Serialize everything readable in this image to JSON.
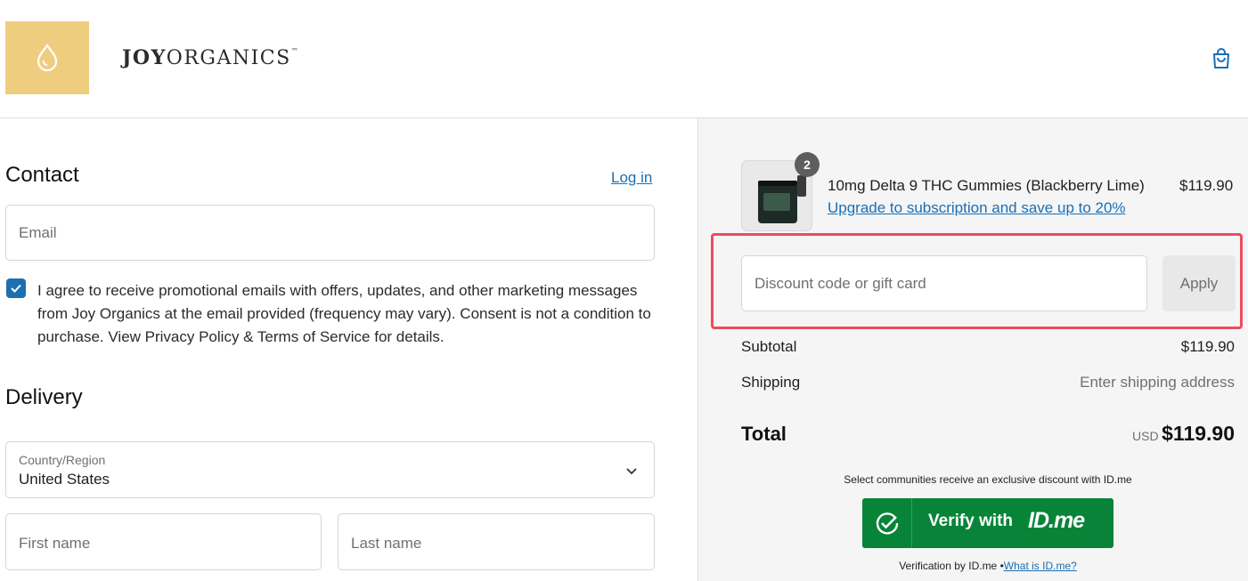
{
  "header": {
    "brand_bold": "JOY",
    "brand_regular": "ORGANICS",
    "brand_tm": "™",
    "icons": {
      "logo": "droplet-icon",
      "cart": "shopping-bag-icon"
    },
    "logo_color": "#efcd7e"
  },
  "contact": {
    "title": "Contact",
    "login_label": "Log in",
    "email_placeholder": "Email",
    "consent_checked": true,
    "consent_text": "I agree to receive promotional emails with offers, updates, and other marketing messages from Joy Organics at the email provided (frequency may vary). Consent is not a condition to purchase. View Privacy Policy & Terms of Service for details."
  },
  "delivery": {
    "title": "Delivery",
    "country_label": "Country/Region",
    "country_value": "United States",
    "first_name_placeholder": "First name",
    "last_name_placeholder": "Last name"
  },
  "summary": {
    "item": {
      "quantity": "2",
      "name": "10mg Delta 9 THC Gummies (Blackberry Lime)",
      "price": "$119.90",
      "upgrade_link": "Upgrade to subscription and save up to 20%"
    },
    "discount_placeholder": "Discount code or gift card",
    "apply_label": "Apply",
    "subtotal_label": "Subtotal",
    "subtotal_value": "$119.90",
    "shipping_label": "Shipping",
    "shipping_value": "Enter shipping address",
    "total_label": "Total",
    "total_currency": "USD",
    "total_value": "$119.90"
  },
  "idme": {
    "note": "Select communities receive an exclusive discount with ID.me",
    "verify_label": "Verify with",
    "logo_text": "ID.me",
    "footer_text": "Verification by ID.me •",
    "footer_link": "What is ID.me?",
    "button_color": "#078438"
  },
  "colors": {
    "link": "#1a6fb5",
    "highlight": "#ee4b5f",
    "sidebar_bg": "#f5f5f5"
  }
}
